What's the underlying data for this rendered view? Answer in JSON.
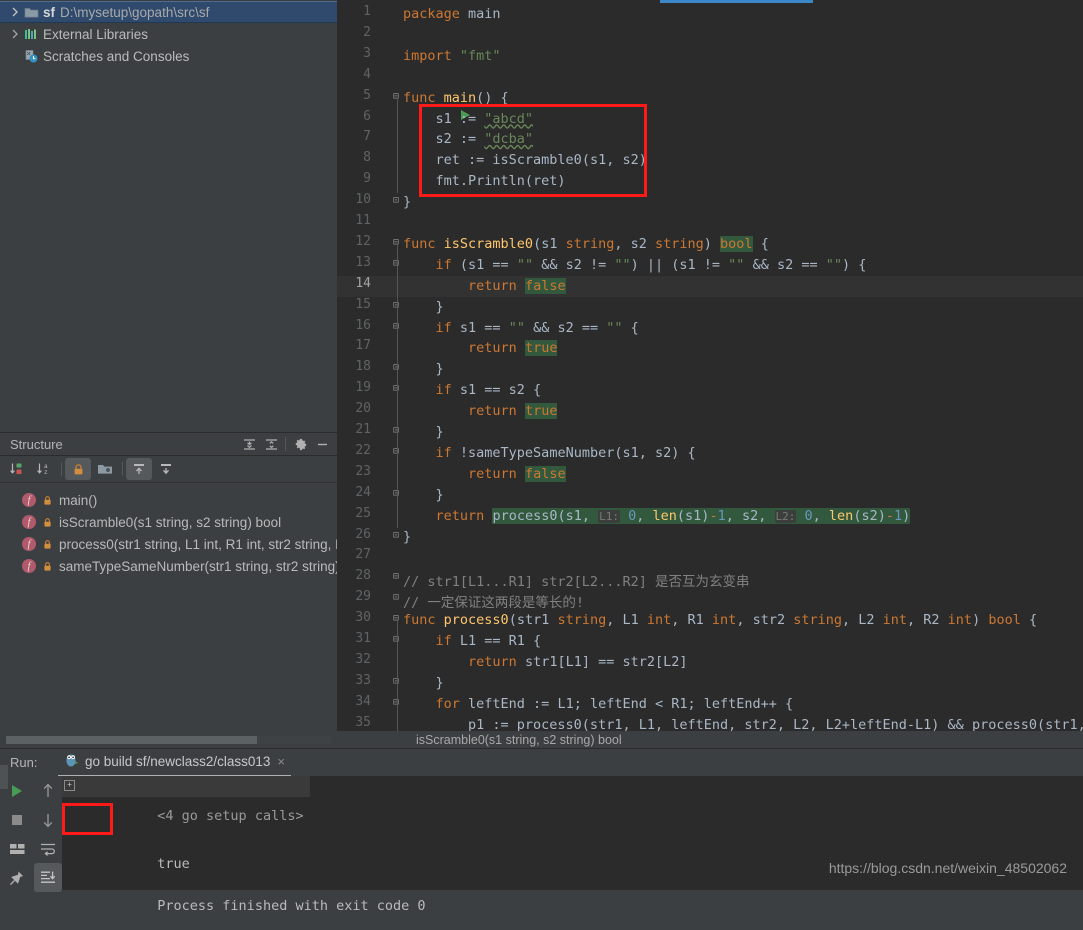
{
  "window": {
    "accent_blue": "#3c87c7",
    "annotation_red": "#ff1a1a",
    "editor_bg": "#2b2b2b",
    "panel_bg": "#3c3f41"
  },
  "project_tree": {
    "items": [
      {
        "label": "sf",
        "path": "D:\\mysetup\\gopath\\src\\sf",
        "icon": "folder-module-icon",
        "expanded": false,
        "selected": true
      },
      {
        "label": "External Libraries",
        "icon": "library-icon",
        "expanded": false,
        "selected": false
      },
      {
        "label": "Scratches and Consoles",
        "icon": "scratches-icon",
        "expanded": false,
        "selected": false
      }
    ]
  },
  "structure": {
    "title": "Structure",
    "header_icons": [
      "expand-all-icon",
      "collapse-all-icon",
      "gear-icon",
      "minimize-icon"
    ],
    "toolbar_icons": [
      {
        "name": "sort-by-visibility-icon",
        "active": false
      },
      {
        "name": "sort-alphabetically-icon",
        "active": false
      },
      {
        "name": "show-non-public-icon",
        "active": true
      },
      {
        "name": "show-fields-icon",
        "active": false
      },
      {
        "name": "show-inherited-icon",
        "active": true
      },
      {
        "name": "show-anonymous-icon",
        "active": false
      }
    ],
    "items": [
      {
        "kind": "f",
        "label": "main()"
      },
      {
        "kind": "f",
        "label": "isScramble0(s1 string, s2 string) bool"
      },
      {
        "kind": "f",
        "label": "process0(str1 string, L1 int, R1 int, str2 string, L"
      },
      {
        "kind": "f",
        "label": "sameTypeSameNumber(str1 string, str2 string)"
      }
    ]
  },
  "editor": {
    "breadcrumb": "isScramble0(s1 string, s2 string) bool",
    "current_line": 14,
    "run_marker_line": 5,
    "lines": [
      {
        "n": 1,
        "fold": "",
        "text": "package main"
      },
      {
        "n": 2,
        "fold": "",
        "text": ""
      },
      {
        "n": 3,
        "fold": "",
        "text": "import \"fmt\""
      },
      {
        "n": 4,
        "fold": "",
        "text": ""
      },
      {
        "n": 5,
        "fold": "-",
        "text": "func main() {"
      },
      {
        "n": 6,
        "fold": "",
        "text": "    s1 := \"abcd\""
      },
      {
        "n": 7,
        "fold": "",
        "text": "    s2 := \"dcba\""
      },
      {
        "n": 8,
        "fold": "",
        "text": "    ret := isScramble0(s1, s2)"
      },
      {
        "n": 9,
        "fold": "",
        "text": "    fmt.Println(ret)"
      },
      {
        "n": 10,
        "fold": "+",
        "text": "}"
      },
      {
        "n": 11,
        "fold": "",
        "text": ""
      },
      {
        "n": 12,
        "fold": "-",
        "text": "func isScramble0(s1 string, s2 string) bool {"
      },
      {
        "n": 13,
        "fold": "-",
        "text": "    if (s1 == \"\" && s2 != \"\") || (s1 != \"\" && s2 == \"\") {"
      },
      {
        "n": 14,
        "fold": "",
        "text": "        return false"
      },
      {
        "n": 15,
        "fold": "+",
        "text": "    }"
      },
      {
        "n": 16,
        "fold": "-",
        "text": "    if s1 == \"\" && s2 == \"\" {"
      },
      {
        "n": 17,
        "fold": "",
        "text": "        return true"
      },
      {
        "n": 18,
        "fold": "+",
        "text": "    }"
      },
      {
        "n": 19,
        "fold": "-",
        "text": "    if s1 == s2 {"
      },
      {
        "n": 20,
        "fold": "",
        "text": "        return true"
      },
      {
        "n": 21,
        "fold": "+",
        "text": "    }"
      },
      {
        "n": 22,
        "fold": "-",
        "text": "    if !sameTypeSameNumber(s1, s2) {"
      },
      {
        "n": 23,
        "fold": "",
        "text": "        return false"
      },
      {
        "n": 24,
        "fold": "+",
        "text": "    }"
      },
      {
        "n": 25,
        "fold": "",
        "text": "    return process0(s1,  L1: 0, len(s1)-1, s2,  L2: 0, len(s2)-1)"
      },
      {
        "n": 26,
        "fold": "+",
        "text": "}"
      },
      {
        "n": 27,
        "fold": "",
        "text": ""
      },
      {
        "n": 28,
        "fold": "-",
        "text": "// str1[L1...R1] str2[L2...R2] 是否互为玄变串"
      },
      {
        "n": 29,
        "fold": "+",
        "text": "// 一定保证这两段是等长的!"
      },
      {
        "n": 30,
        "fold": "-",
        "text": "func process0(str1 string, L1 int, R1 int, str2 string, L2 int, R2 int) bool {"
      },
      {
        "n": 31,
        "fold": "-",
        "text": "    if L1 == R1 {"
      },
      {
        "n": 32,
        "fold": "",
        "text": "        return str1[L1] == str2[L2]"
      },
      {
        "n": 33,
        "fold": "+",
        "text": "    }"
      },
      {
        "n": 34,
        "fold": "-",
        "text": "    for leftEnd := L1; leftEnd < R1; leftEnd++ {"
      },
      {
        "n": 35,
        "fold": "",
        "text": "        p1 := process0(str1, L1, leftEnd, str2, L2, L2+leftEnd-L1) && process0(str1, "
      }
    ],
    "inlay_hints": [
      {
        "line": 25,
        "label": "L1:"
      },
      {
        "line": 25,
        "label": "L2:"
      }
    ]
  },
  "run_panel": {
    "label": "Run:",
    "tab": {
      "title": "go build sf/newclass2/class013",
      "icon": "go-gopher-icon",
      "close": "×"
    },
    "side_buttons": [
      {
        "name": "rerun-button",
        "icon": "play-icon"
      },
      {
        "name": "stop-button",
        "icon": "stop-icon"
      },
      {
        "name": "layout-button",
        "icon": "layout-icon"
      },
      {
        "name": "pin-button",
        "icon": "pin-icon"
      }
    ],
    "nav_buttons": [
      {
        "name": "up-the-stack-trace-button",
        "icon": "arrow-up-icon",
        "active": false
      },
      {
        "name": "down-the-stack-trace-button",
        "icon": "arrow-down-icon",
        "active": false
      },
      {
        "name": "soft-wrap-button",
        "icon": "soft-wrap-icon",
        "active": false
      },
      {
        "name": "scroll-to-end-button",
        "icon": "scroll-to-end-icon",
        "active": true
      }
    ],
    "console_lines": [
      {
        "text": "<4 go setup calls>",
        "collapsed": true,
        "expander": "+"
      },
      {
        "text": "true",
        "highlighted": true
      },
      {
        "text": ""
      },
      {
        "text": "Process finished with exit code 0"
      }
    ]
  },
  "watermark": "https://blog.csdn.net/weixin_48502062"
}
